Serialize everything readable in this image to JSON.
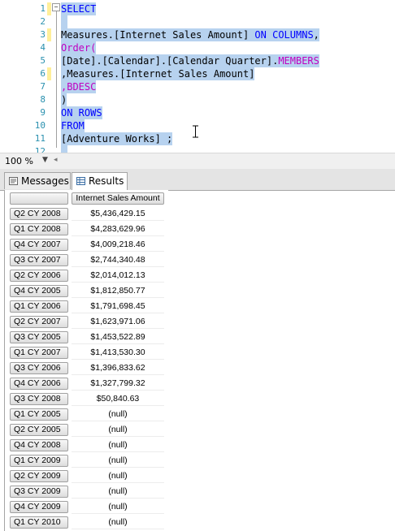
{
  "editor": {
    "line_numbers": [
      "1",
      "2",
      "3",
      "4",
      "5",
      "6",
      "7",
      "8",
      "9",
      "10",
      "11",
      "12"
    ],
    "lines": [
      [
        {
          "t": "SELECT",
          "c": "kw"
        }
      ],
      [],
      [
        {
          "t": "Measures.[Internet Sales Amount] ",
          "c": ""
        },
        {
          "t": "ON COLUMNS",
          "c": "kw"
        },
        {
          "t": ",",
          "c": ""
        }
      ],
      [
        {
          "t": "Order(",
          "c": "mag"
        }
      ],
      [
        {
          "t": "[Date].[Calendar].[Calendar Quarter].",
          "c": ""
        },
        {
          "t": "MEMBERS",
          "c": "mag"
        }
      ],
      [
        {
          "t": ",Measures.[Internet Sales Amount]",
          "c": ""
        }
      ],
      [
        {
          "t": ",BDESC",
          "c": "mag"
        }
      ],
      [
        {
          "t": ")",
          "c": ""
        }
      ],
      [
        {
          "t": "ON ROWS",
          "c": "kw"
        }
      ],
      [
        {
          "t": "FROM",
          "c": "kw"
        }
      ],
      [
        {
          "t": "[Adventure Works] ;",
          "c": ""
        }
      ],
      []
    ]
  },
  "status": {
    "zoom": "100 %"
  },
  "tabs": {
    "messages": "Messages",
    "results": "Results"
  },
  "results": {
    "column_header": "Internet Sales Amount",
    "rows": [
      {
        "label": "Q2 CY 2008",
        "value": "$5,436,429.15"
      },
      {
        "label": "Q1 CY 2008",
        "value": "$4,283,629.96"
      },
      {
        "label": "Q4 CY 2007",
        "value": "$4,009,218.46"
      },
      {
        "label": "Q3 CY 2007",
        "value": "$2,744,340.48"
      },
      {
        "label": "Q2 CY 2006",
        "value": "$2,014,012.13"
      },
      {
        "label": "Q4 CY 2005",
        "value": "$1,812,850.77"
      },
      {
        "label": "Q1 CY 2006",
        "value": "$1,791,698.45"
      },
      {
        "label": "Q2 CY 2007",
        "value": "$1,623,971.06"
      },
      {
        "label": "Q3 CY 2005",
        "value": "$1,453,522.89"
      },
      {
        "label": "Q1 CY 2007",
        "value": "$1,413,530.30"
      },
      {
        "label": "Q3 CY 2006",
        "value": "$1,396,833.62"
      },
      {
        "label": "Q4 CY 2006",
        "value": "$1,327,799.32"
      },
      {
        "label": "Q3 CY 2008",
        "value": "$50,840.63"
      },
      {
        "label": "Q1 CY 2005",
        "value": "(null)"
      },
      {
        "label": "Q2 CY 2005",
        "value": "(null)"
      },
      {
        "label": "Q4 CY 2008",
        "value": "(null)"
      },
      {
        "label": "Q1 CY 2009",
        "value": "(null)"
      },
      {
        "label": "Q2 CY 2009",
        "value": "(null)"
      },
      {
        "label": "Q3 CY 2009",
        "value": "(null)"
      },
      {
        "label": "Q4 CY 2009",
        "value": "(null)"
      },
      {
        "label": "Q1 CY 2010",
        "value": "(null)"
      }
    ]
  }
}
